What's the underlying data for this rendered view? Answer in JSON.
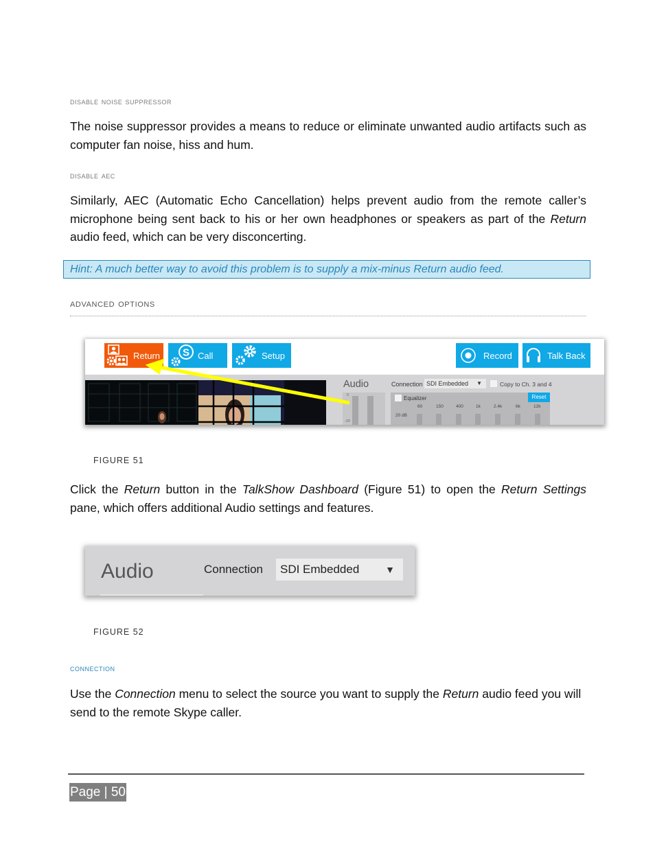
{
  "sections": {
    "noise_heading": "Disable Noise Suppressor",
    "noise_body": "The noise suppressor provides a means to reduce or eliminate unwanted audio artifacts such as computer fan noise, hiss and hum.",
    "aec_heading": "Disable AEC",
    "aec_body_pre": "Similarly, AEC (Automatic Echo Cancellation) helps prevent audio from the remote caller’s microphone being sent back to his or her own headphones or speakers as part of the ",
    "aec_body_italic": "Return",
    "aec_body_post": " audio feed, which can be very disconcerting.",
    "hint": "Hint: A much better way to avoid this problem is to supply a mix-minus Return audio feed.",
    "advanced_heading": "Advanced Options",
    "fig51_caption": "FIGURE 51",
    "click_p": {
      "t1": "Click the ",
      "i1": "Return",
      "t2": " button in the ",
      "i2": "TalkShow Dashboard",
      "t3": " (Figure 51) to open the ",
      "i3": "Return Settings",
      "t4": " pane, which offers additional Audio settings and features."
    },
    "fig52_caption": "FIGURE 52",
    "connection_heading": "Connection",
    "conn_p": {
      "t1": "Use the ",
      "i1": "Connection",
      "t2": " menu to select the source you want to supply the ",
      "i2": "Return",
      "t3": " audio feed you will send to the remote Skype caller."
    }
  },
  "figure51": {
    "buttons": {
      "return": "Return",
      "call": "Call",
      "setup": "Setup",
      "record": "Record",
      "talkback": "Talk Back"
    },
    "colors": {
      "return_bg": "#f15a0b",
      "blue_bg": "#11a8e6",
      "arrow": "#ffff00"
    },
    "audio_label": "Audio",
    "meter_top": "0",
    "meter_low": "-20",
    "connection_label": "Connection",
    "connection_value": "SDI Embedded",
    "copy_label": "Copy to Ch. 3 and 4",
    "equalizer_label": "Equalizer",
    "reset_label": "Reset",
    "eq_bands": [
      "60",
      "150",
      "400",
      "1k",
      "2.4k",
      "6k",
      "12k"
    ],
    "eq_db": "20 dB"
  },
  "figure52": {
    "audio_label": "Audio",
    "connection_label": "Connection",
    "connection_value": "SDI Embedded"
  },
  "footer": {
    "page": "Page | 50"
  }
}
